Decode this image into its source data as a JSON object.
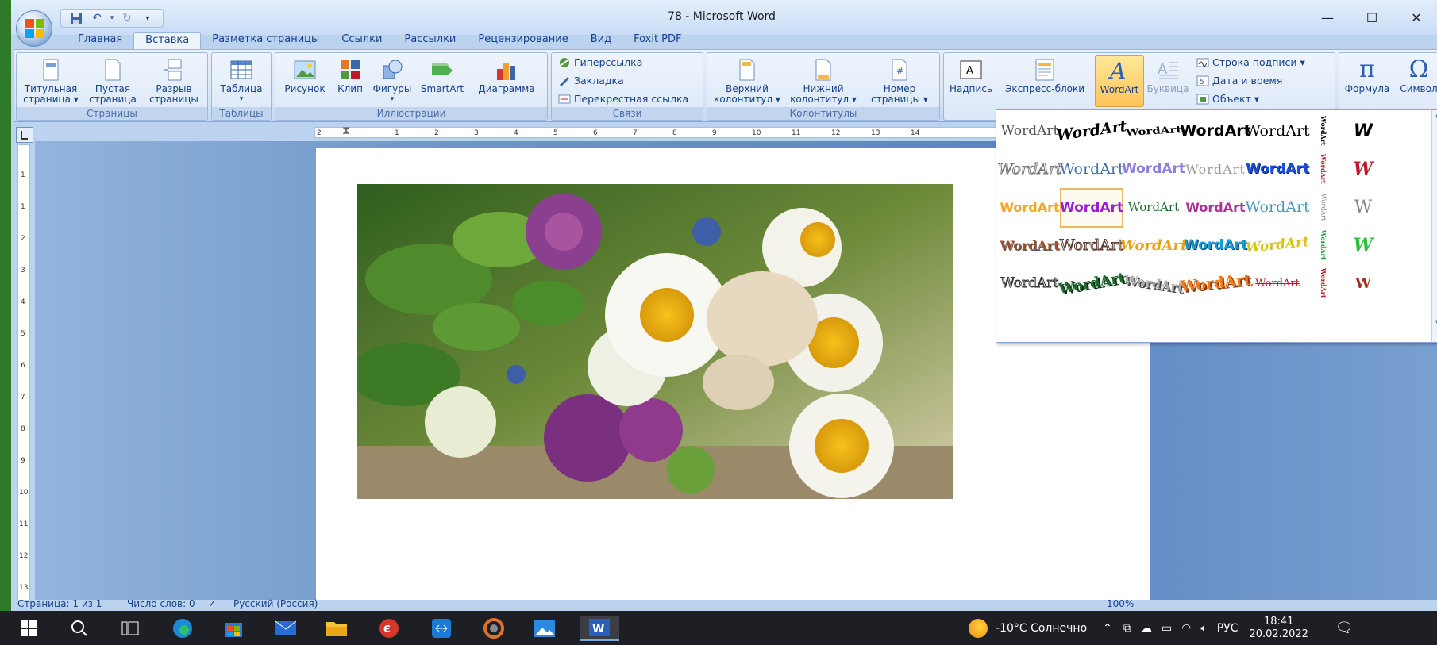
{
  "window": {
    "title": "78 - Microsoft Word"
  },
  "qat": {
    "save": "save-icon",
    "undo": "undo-icon",
    "redo": "redo-icon",
    "customize": "▾"
  },
  "tabs": [
    "Главная",
    "Вставка",
    "Разметка страницы",
    "Ссылки",
    "Рассылки",
    "Рецензирование",
    "Вид",
    "Foxit PDF"
  ],
  "ribbon": {
    "pages": {
      "label": "Страницы",
      "title_page": "Титульная\nстраница ▾",
      "blank_page": "Пустая\nстраница",
      "page_break": "Разрыв\nстраницы"
    },
    "tables": {
      "label": "Таблицы",
      "table": "Таблица"
    },
    "illustrations": {
      "label": "Иллюстрации",
      "picture": "Рисунок",
      "clip": "Клип",
      "shapes": "Фигуры",
      "smartart": "SmartArt",
      "chart": "Диаграмма"
    },
    "links": {
      "label": "Связи",
      "hyperlink": "Гиперссылка",
      "bookmark": "Закладка",
      "crossref": "Перекрестная ссылка"
    },
    "headers": {
      "label": "Колонтитулы",
      "header": "Верхний\nколонтитул ▾",
      "footer": "Нижний\nколонтитул ▾",
      "page_number": "Номер\nстраницы ▾"
    },
    "text": {
      "textbox": "Надпись",
      "quickparts": "Экспресс-блоки",
      "wordart": "WordArt",
      "dropcap": "Буквица",
      "signature": "Строка подписи ▾",
      "datetime": "Дата и время",
      "object": "Объект ▾"
    },
    "symbols": {
      "equation": "Формула",
      "symbol": "Символ"
    }
  },
  "ruler": {
    "marks": [
      "2",
      "1",
      "1",
      "2",
      "3",
      "4",
      "5",
      "6",
      "7",
      "8",
      "9",
      "10",
      "11",
      "12",
      "13",
      "14"
    ]
  },
  "vruler": {
    "marks": [
      "1",
      "1",
      "2",
      "3",
      "4",
      "5",
      "6",
      "7",
      "8",
      "9",
      "10",
      "11",
      "12",
      "13"
    ]
  },
  "gallery": {
    "sample": "WordArt",
    "colors": {
      "orange": "#f5a623",
      "purple": "#9b1fd1",
      "blue": "#1d4fd6",
      "red": "#c0182a",
      "green": "#1f6b2e"
    }
  },
  "status": {
    "page": "Страница: 1 из 1",
    "words": "Число слов: 0",
    "lang": "Русский (Россия)",
    "zoom": "100%"
  },
  "taskbar": {
    "weather": "-10°C  Солнечно",
    "lang": "РУС",
    "time": "18:41",
    "date": "20.02.2022"
  }
}
